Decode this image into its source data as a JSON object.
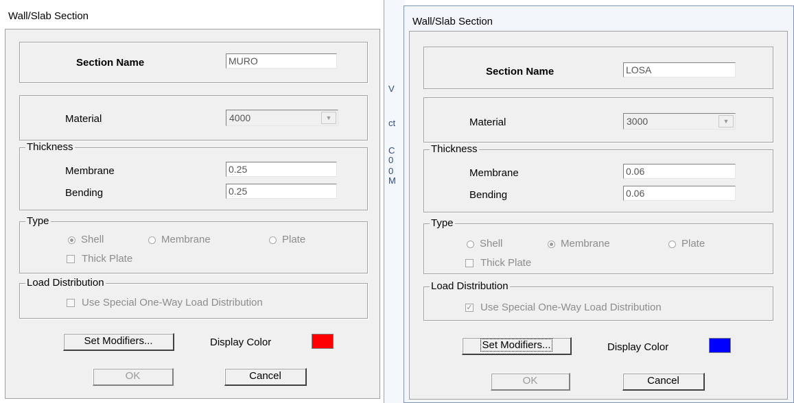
{
  "background_fragments": [
    "V",
    "ct",
    "C",
    "0",
    "0",
    "M"
  ],
  "dialogs": [
    {
      "title": "Wall/Slab Section",
      "section_name_label": "Section Name",
      "section_name_value": "MURO",
      "material_label": "Material",
      "material_value": "4000",
      "thickness_legend": "Thickness",
      "membrane_label": "Membrane",
      "membrane_value": "0.25",
      "bending_label": "Bending",
      "bending_value": "0.25",
      "type_legend": "Type",
      "type_options": [
        "Shell",
        "Membrane",
        "Plate"
      ],
      "type_selected": "Shell",
      "thick_plate_label": "Thick Plate",
      "thick_plate_checked": false,
      "load_legend": "Load Distribution",
      "one_way_label": "Use Special One-Way Load Distribution",
      "one_way_checked": false,
      "set_modifiers_label": "Set Modifiers...",
      "display_color_label": "Display Color",
      "display_color": "#ff0000",
      "ok_label": "OK",
      "cancel_label": "Cancel"
    },
    {
      "title": "Wall/Slab Section",
      "section_name_label": "Section Name",
      "section_name_value": "LOSA",
      "material_label": "Material",
      "material_value": "3000",
      "thickness_legend": "Thickness",
      "membrane_label": "Membrane",
      "membrane_value": "0.06",
      "bending_label": "Bending",
      "bending_value": "0.06",
      "type_legend": "Type",
      "type_options": [
        "Shell",
        "Membrane",
        "Plate"
      ],
      "type_selected": "Membrane",
      "thick_plate_label": "Thick Plate",
      "thick_plate_checked": false,
      "load_legend": "Load Distribution",
      "one_way_label": "Use Special One-Way Load Distribution",
      "one_way_checked": true,
      "set_modifiers_label": "Set Modifiers...",
      "display_color_label": "Display Color",
      "display_color": "#0000ff",
      "ok_label": "OK",
      "cancel_label": "Cancel"
    }
  ]
}
